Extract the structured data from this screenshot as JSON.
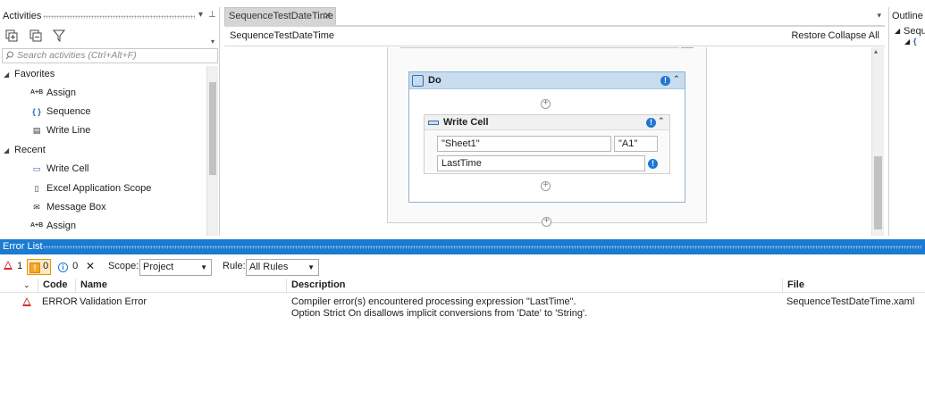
{
  "activities": {
    "title": "Activities",
    "search_placeholder": "Search activities (Ctrl+Alt+F)",
    "groups": [
      {
        "label": "Favorites",
        "items": [
          {
            "label": "Assign",
            "icon": "assign-icon"
          },
          {
            "label": "Sequence",
            "icon": "sequence-icon"
          },
          {
            "label": "Write Line",
            "icon": "write-line-icon"
          }
        ]
      },
      {
        "label": "Recent",
        "items": [
          {
            "label": "Write Cell",
            "icon": "write-cell-icon"
          },
          {
            "label": "Excel Application Scope",
            "icon": "excel-scope-icon"
          },
          {
            "label": "Message Box",
            "icon": "message-box-icon"
          },
          {
            "label": "Assign",
            "icon": "assign-icon"
          }
        ]
      }
    ]
  },
  "designer": {
    "tab_label": "SequenceTestDateTime",
    "breadcrumb": "SequenceTestDateTime",
    "restore_label": "Restore",
    "collapse_all_label": "Collapse All",
    "do_block": {
      "title": "Do",
      "write_cell": {
        "title": "Write Cell",
        "sheet_value": "\"Sheet1\"",
        "range_value": "\"A1\"",
        "value_expression": "LastTime"
      }
    }
  },
  "outline": {
    "title": "Outline",
    "item": "Seque"
  },
  "error_list": {
    "title": "Error List",
    "error_count": "1",
    "warning_count": "0",
    "message_count": "0",
    "scope_label": "Scope:",
    "scope_value": "Project",
    "rule_label": "Rule:",
    "rule_value": "All Rules",
    "columns": {
      "code": "Code",
      "name": "Name",
      "description": "Description",
      "file": "File"
    },
    "rows": [
      {
        "code": "ERROR",
        "name": "Validation Error",
        "description_line1": "Compiler error(s) encountered processing expression \"LastTime\".",
        "description_line2": "Option Strict On disallows implicit conversions from 'Date' to 'String'.",
        "file": "SequenceTestDateTime.xaml"
      }
    ]
  },
  "colors": {
    "accent": "#1b7bd1",
    "error": "#d32f2f",
    "warning": "#f5a623",
    "do_header": "#c7dcee"
  }
}
